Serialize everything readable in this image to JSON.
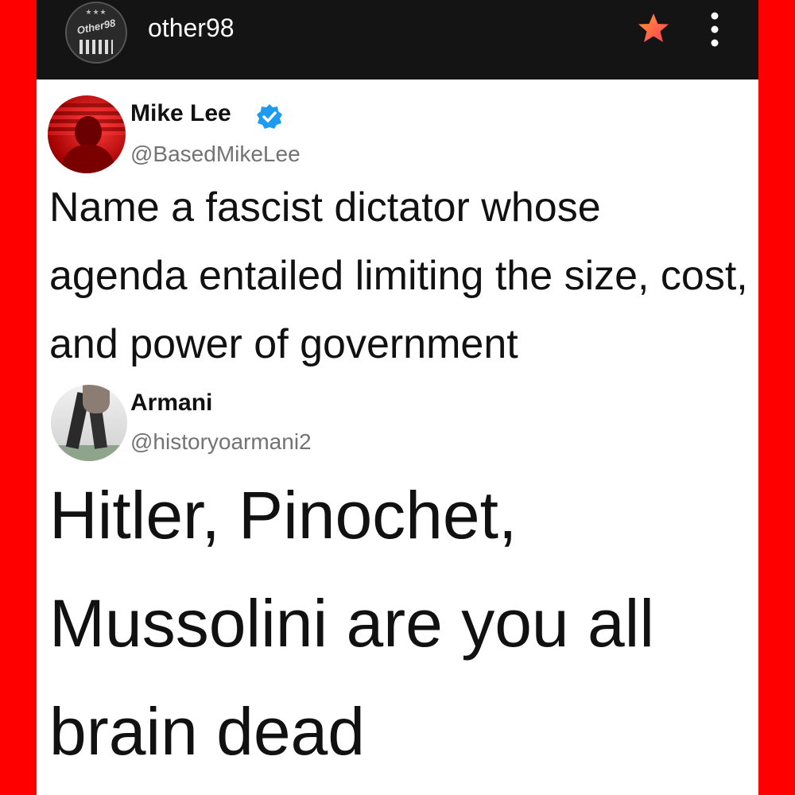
{
  "header": {
    "channel_name": "other98",
    "logo_text": "Other98",
    "logo_stars": "★★★",
    "logo_icon": "other98-logo-icon",
    "favorite_icon": "star-icon",
    "menu_icon": "more-vertical-icon"
  },
  "posts": [
    {
      "name": "Mike Lee",
      "verified": true,
      "handle": "@BasedMikeLee",
      "text": "Name a fascist dictator whose agenda entailed limiting the size, cost, and power of government"
    },
    {
      "name": "Armani",
      "verified": false,
      "handle": "@historyoarmani2",
      "text": "Hitler, Pinochet, Mussolini are you all brain dead"
    }
  ],
  "colors": {
    "border": "#ff0000",
    "topbar": "#141414",
    "verified": "#1d9bf0",
    "handle": "#737373"
  }
}
